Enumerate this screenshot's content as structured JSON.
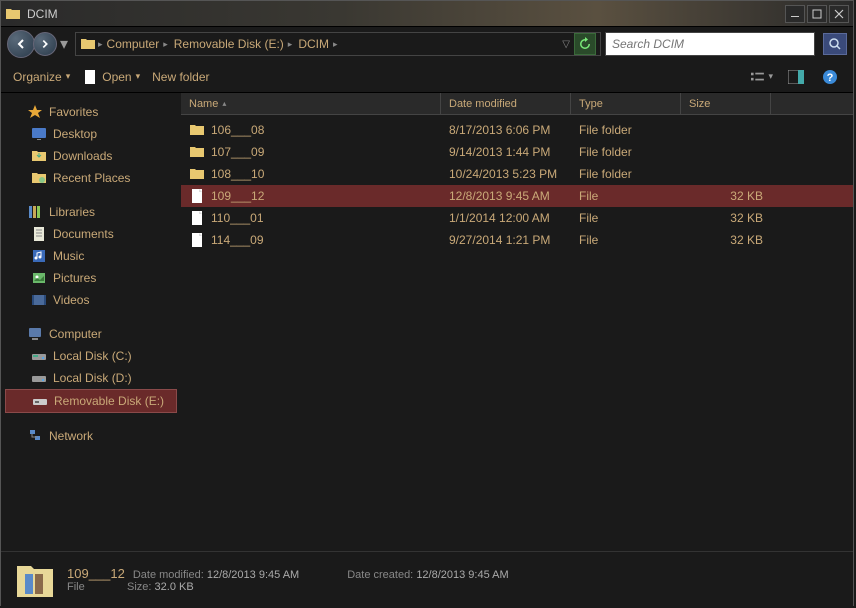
{
  "title": "DCIM",
  "breadcrumb": [
    "Computer",
    "Removable Disk (E:)",
    "DCIM"
  ],
  "search": {
    "placeholder": "Search DCIM"
  },
  "toolbar": {
    "organize": "Organize",
    "open": "Open",
    "newfolder": "New folder"
  },
  "sidebar": {
    "favorites": {
      "label": "Favorites",
      "items": [
        "Desktop",
        "Downloads",
        "Recent Places"
      ]
    },
    "libraries": {
      "label": "Libraries",
      "items": [
        "Documents",
        "Music",
        "Pictures",
        "Videos"
      ]
    },
    "computer": {
      "label": "Computer",
      "items": [
        "Local Disk (C:)",
        "Local Disk (D:)",
        "Removable Disk (E:)"
      ]
    },
    "network": {
      "label": "Network"
    }
  },
  "columns": {
    "name": "Name",
    "date": "Date modified",
    "type": "Type",
    "size": "Size"
  },
  "files": [
    {
      "name": "106___08",
      "date": "8/17/2013 6:06 PM",
      "type": "File folder",
      "size": "",
      "icon": "folder"
    },
    {
      "name": "107___09",
      "date": "9/14/2013 1:44 PM",
      "type": "File folder",
      "size": "",
      "icon": "folder"
    },
    {
      "name": "108___10",
      "date": "10/24/2013 5:23 PM",
      "type": "File folder",
      "size": "",
      "icon": "folder"
    },
    {
      "name": "109___12",
      "date": "12/8/2013 9:45 AM",
      "type": "File",
      "size": "32 KB",
      "icon": "file",
      "selected": true
    },
    {
      "name": "110___01",
      "date": "1/1/2014 12:00 AM",
      "type": "File",
      "size": "32 KB",
      "icon": "file"
    },
    {
      "name": "114___09",
      "date": "9/27/2014 1:21 PM",
      "type": "File",
      "size": "32 KB",
      "icon": "file"
    }
  ],
  "details": {
    "name": "109___12",
    "type": "File",
    "modified_label": "Date modified:",
    "modified": "12/8/2013 9:45 AM",
    "created_label": "Date created:",
    "created": "12/8/2013 9:45 AM",
    "size_label": "Size:",
    "size": "32.0 KB"
  }
}
